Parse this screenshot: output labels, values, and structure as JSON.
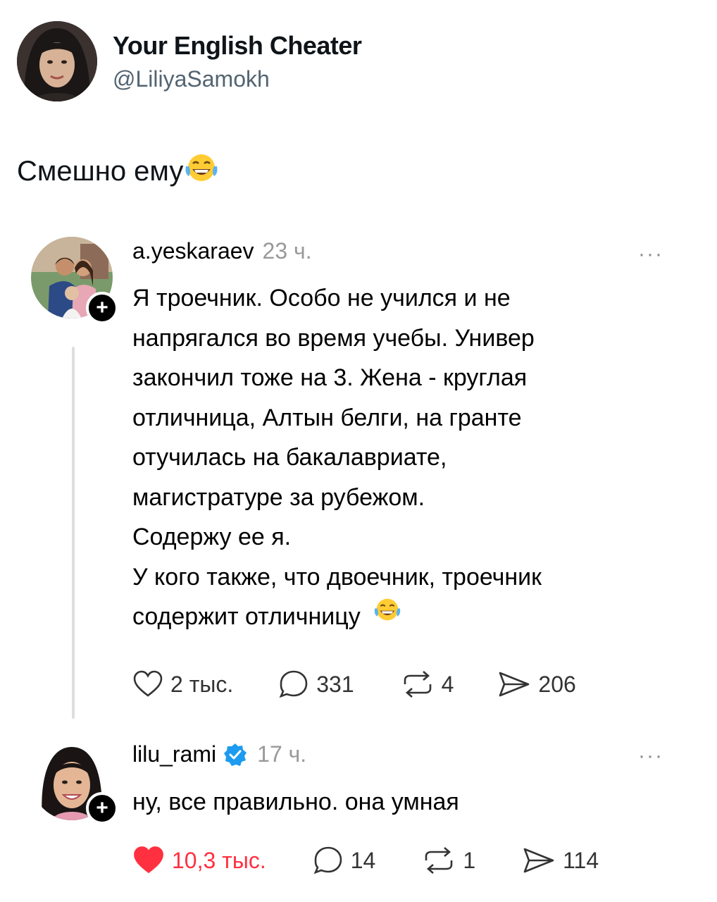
{
  "tweet": {
    "display_name": "Your English Cheater",
    "handle": "@LiliyaSamokh",
    "text": "Смешно ему",
    "emoji_icon": "face-with-tears-of-joy-icon"
  },
  "posts": [
    {
      "username": "a.yeskaraev",
      "time": "23 ч.",
      "more": "···",
      "lines": [
        "Я троечник. Особо не учился и не",
        "напрягался во время учебы. Универ",
        "закончил тоже на 3. Жена - круглая",
        "отличница, Алтын белги, на гранте",
        "отучилась на бакалавриате,",
        "магистратуре за рубежом.",
        "Содержу ее я.",
        "У кого также, что двоечник, троечник",
        "содержит отличницу"
      ],
      "likes": "2 тыс.",
      "replies": "331",
      "reposts": "4",
      "shares": "206",
      "liked": false
    },
    {
      "username": "lilu_rami",
      "verified": true,
      "time": "17 ч.",
      "more": "···",
      "text": "ну, все правильно. она умная",
      "likes": "10,3 тыс.",
      "replies": "14",
      "reposts": "1",
      "shares": "114",
      "liked": true
    }
  ],
  "colors": {
    "like_active": "#ff3040",
    "verified": "#1d9bf0",
    "muted": "#999999",
    "handle": "#536471"
  }
}
